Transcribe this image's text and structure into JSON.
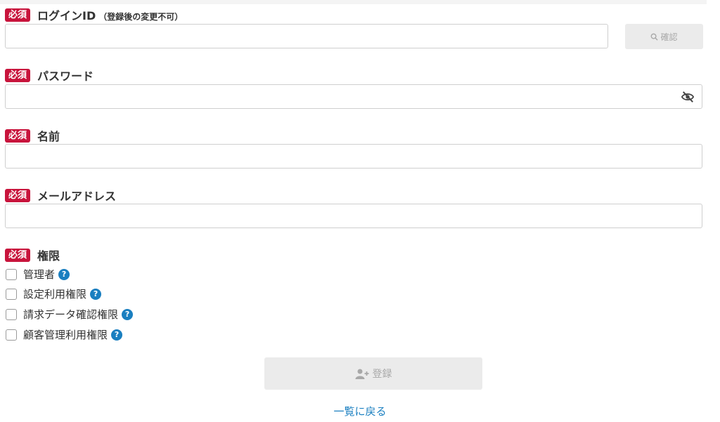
{
  "required_badge": "必須",
  "login_id": {
    "label": "ログインID",
    "note": "（登録後の変更不可）",
    "value": "",
    "confirm_label": "確認",
    "confirm_icon": "search-icon"
  },
  "password": {
    "label": "パスワード",
    "value": "",
    "toggle_icon": "eye-slash-icon"
  },
  "name": {
    "label": "名前",
    "value": ""
  },
  "email": {
    "label": "メールアドレス",
    "value": ""
  },
  "permissions": {
    "label": "権限",
    "items": [
      {
        "label": "管理者",
        "checked": false
      },
      {
        "label": "設定利用権限",
        "checked": false
      },
      {
        "label": "請求データ確認権限",
        "checked": false
      },
      {
        "label": "顧客管理利用権限",
        "checked": false
      }
    ],
    "help_glyph": "?"
  },
  "submit": {
    "label": "登録",
    "icon": "user-plus-icon"
  },
  "back_link": "一覧に戻る",
  "colors": {
    "required": "#c8143c",
    "link": "#1a7fc0",
    "disabled_bg": "#ebebeb",
    "disabled_text": "#a8a8a8"
  }
}
